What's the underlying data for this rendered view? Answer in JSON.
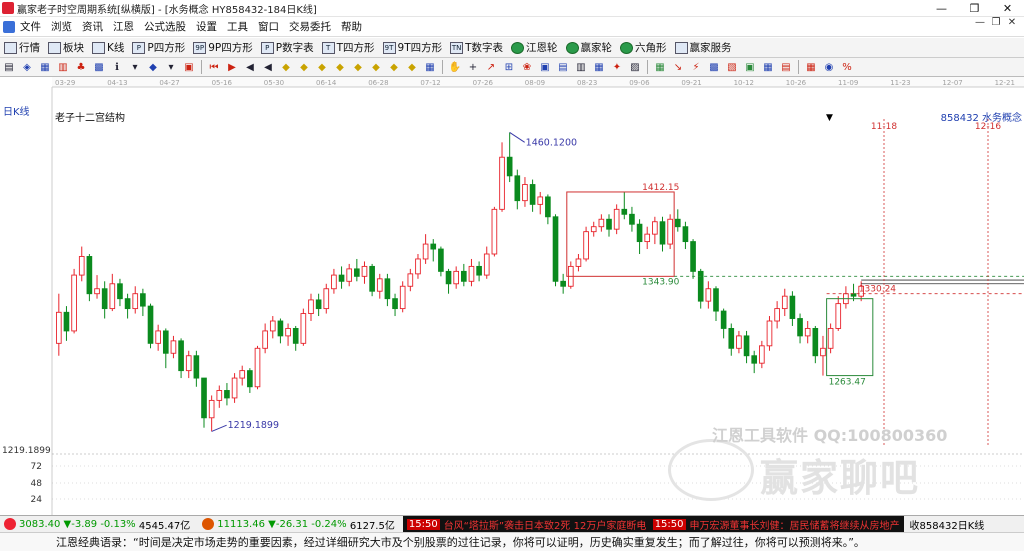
{
  "window": {
    "title": "赢家老子时空周期系统[纵横版] - [水务概念  HY858432-184日K线]",
    "controls": [
      "—",
      "❐",
      "✕"
    ]
  },
  "menu": {
    "items": [
      "文件",
      "浏览",
      "资讯",
      "江恩",
      "公式选股",
      "设置",
      "工具",
      "窗口",
      "交易委托",
      "帮助"
    ],
    "mdi_controls": [
      "—",
      "❐",
      "✕"
    ]
  },
  "toolbar": {
    "items": [
      {
        "label": "行情",
        "icon": "quote-icon"
      },
      {
        "label": "板块",
        "icon": "sector-icon"
      },
      {
        "label": "K线",
        "icon": "kline-icon"
      },
      {
        "label": "P四方形",
        "icon": "square-icon",
        "tag": "P"
      },
      {
        "label": "9P四方形",
        "icon": "square-icon",
        "tag": "9P"
      },
      {
        "label": "P数字表",
        "icon": "table-icon",
        "tag": "P"
      },
      {
        "label": "T四方形",
        "icon": "square-icon",
        "tag": "T"
      },
      {
        "label": "9T四方形",
        "icon": "square-icon",
        "tag": "9T"
      },
      {
        "label": "T数字表",
        "icon": "table-icon",
        "tag": "TN"
      },
      {
        "label": "江恩轮",
        "icon": "wheel-icon"
      },
      {
        "label": "赢家轮",
        "icon": "wheel-icon"
      },
      {
        "label": "六角形",
        "icon": "hexagon-icon"
      },
      {
        "label": "赢家服务",
        "icon": "service-icon"
      }
    ]
  },
  "chart_data": {
    "type": "candlestick",
    "period_label": "日K线",
    "study_label": "老子十二宫结构",
    "stock_label": "858432 水务概念",
    "x_dates": [
      "03-29",
      "04-13",
      "04-27",
      "05-16",
      "05-30",
      "06-14",
      "06-28",
      "07-12",
      "07-26",
      "08-09",
      "08-23",
      "09-06",
      "09-21",
      "10-12",
      "10-26",
      "11-09",
      "11-23",
      "12-07",
      "12-21"
    ],
    "y_axis_labels": [
      "1219.1899",
      "72",
      "48",
      "24"
    ],
    "annotations": [
      "1460.1200",
      "1412.15",
      "1343.90",
      "1330.24",
      "1263.47",
      "1219.1899",
      "11-18",
      "12-16"
    ],
    "candles": [
      [
        1290,
        1315,
        1330,
        1280
      ],
      [
        1315,
        1300,
        1320,
        1292
      ],
      [
        1300,
        1345,
        1350,
        1298
      ],
      [
        1345,
        1360,
        1368,
        1340
      ],
      [
        1360,
        1330,
        1362,
        1324
      ],
      [
        1330,
        1334,
        1345,
        1326
      ],
      [
        1334,
        1318,
        1340,
        1310
      ],
      [
        1318,
        1338,
        1346,
        1316
      ],
      [
        1338,
        1326,
        1342,
        1320
      ],
      [
        1326,
        1318,
        1330,
        1310
      ],
      [
        1318,
        1330,
        1336,
        1314
      ],
      [
        1330,
        1320,
        1334,
        1312
      ],
      [
        1320,
        1290,
        1322,
        1286
      ],
      [
        1290,
        1300,
        1305,
        1284
      ],
      [
        1300,
        1282,
        1302,
        1270
      ],
      [
        1282,
        1292,
        1296,
        1278
      ],
      [
        1292,
        1268,
        1294,
        1262
      ],
      [
        1268,
        1280,
        1284,
        1262
      ],
      [
        1280,
        1262,
        1284,
        1255
      ],
      [
        1262,
        1230,
        1262,
        1222
      ],
      [
        1230,
        1244,
        1248,
        1219
      ],
      [
        1244,
        1252,
        1256,
        1238
      ],
      [
        1252,
        1246,
        1258,
        1240
      ],
      [
        1246,
        1262,
        1266,
        1242
      ],
      [
        1262,
        1268,
        1272,
        1256
      ],
      [
        1268,
        1255,
        1270,
        1250
      ],
      [
        1255,
        1286,
        1288,
        1253
      ],
      [
        1286,
        1300,
        1306,
        1282
      ],
      [
        1300,
        1308,
        1312,
        1294
      ],
      [
        1308,
        1296,
        1310,
        1290
      ],
      [
        1296,
        1302,
        1306,
        1288
      ],
      [
        1302,
        1290,
        1304,
        1284
      ],
      [
        1290,
        1314,
        1318,
        1288
      ],
      [
        1314,
        1325,
        1330,
        1308
      ],
      [
        1325,
        1318,
        1330,
        1312
      ],
      [
        1318,
        1334,
        1338,
        1314
      ],
      [
        1334,
        1345,
        1350,
        1330
      ],
      [
        1345,
        1340,
        1352,
        1334
      ],
      [
        1340,
        1350,
        1354,
        1336
      ],
      [
        1350,
        1344,
        1358,
        1340
      ],
      [
        1344,
        1352,
        1356,
        1338
      ],
      [
        1352,
        1332,
        1354,
        1328
      ],
      [
        1332,
        1342,
        1346,
        1326
      ],
      [
        1342,
        1326,
        1346,
        1320
      ],
      [
        1326,
        1318,
        1330,
        1312
      ],
      [
        1318,
        1336,
        1340,
        1315
      ],
      [
        1336,
        1346,
        1350,
        1332
      ],
      [
        1346,
        1358,
        1362,
        1342
      ],
      [
        1358,
        1370,
        1378,
        1354
      ],
      [
        1370,
        1366,
        1374,
        1356
      ],
      [
        1366,
        1348,
        1368,
        1344
      ],
      [
        1348,
        1338,
        1350,
        1330
      ],
      [
        1338,
        1348,
        1352,
        1334
      ],
      [
        1348,
        1340,
        1354,
        1336
      ],
      [
        1340,
        1352,
        1358,
        1336
      ],
      [
        1352,
        1345,
        1356,
        1340
      ],
      [
        1345,
        1362,
        1368,
        1342
      ],
      [
        1362,
        1398,
        1400,
        1360
      ],
      [
        1398,
        1440,
        1452,
        1396
      ],
      [
        1440,
        1425,
        1460,
        1420
      ],
      [
        1425,
        1405,
        1430,
        1398
      ],
      [
        1405,
        1418,
        1424,
        1400
      ],
      [
        1418,
        1402,
        1422,
        1396
      ],
      [
        1402,
        1408,
        1412,
        1394
      ],
      [
        1408,
        1392,
        1410,
        1386
      ],
      [
        1392,
        1340,
        1394,
        1336
      ],
      [
        1340,
        1336,
        1346,
        1330
      ],
      [
        1336,
        1352,
        1356,
        1334
      ],
      [
        1352,
        1358,
        1362,
        1348
      ],
      [
        1358,
        1380,
        1384,
        1356
      ],
      [
        1380,
        1384,
        1388,
        1376
      ],
      [
        1384,
        1390,
        1394,
        1380
      ],
      [
        1390,
        1382,
        1394,
        1376
      ],
      [
        1382,
        1398,
        1402,
        1378
      ],
      [
        1398,
        1394,
        1412,
        1390
      ],
      [
        1394,
        1386,
        1400,
        1380
      ],
      [
        1386,
        1372,
        1390,
        1362
      ],
      [
        1372,
        1378,
        1384,
        1366
      ],
      [
        1378,
        1388,
        1392,
        1370
      ],
      [
        1388,
        1370,
        1392,
        1364
      ],
      [
        1370,
        1390,
        1394,
        1366
      ],
      [
        1390,
        1384,
        1398,
        1380
      ],
      [
        1384,
        1372,
        1388,
        1366
      ],
      [
        1372,
        1348,
        1374,
        1342
      ],
      [
        1348,
        1324,
        1350,
        1318
      ],
      [
        1324,
        1334,
        1340,
        1318
      ],
      [
        1334,
        1316,
        1336,
        1308
      ],
      [
        1316,
        1302,
        1318,
        1294
      ],
      [
        1302,
        1286,
        1306,
        1280
      ],
      [
        1286,
        1296,
        1300,
        1282
      ],
      [
        1296,
        1280,
        1300,
        1274
      ],
      [
        1280,
        1274,
        1284,
        1266
      ],
      [
        1274,
        1288,
        1292,
        1270
      ],
      [
        1288,
        1308,
        1312,
        1284
      ],
      [
        1308,
        1318,
        1324,
        1302
      ],
      [
        1318,
        1328,
        1334,
        1312
      ],
      [
        1328,
        1310,
        1332,
        1304
      ],
      [
        1310,
        1296,
        1314,
        1290
      ],
      [
        1296,
        1302,
        1308,
        1290
      ],
      [
        1302,
        1280,
        1304,
        1274
      ],
      [
        1280,
        1286,
        1296,
        1264
      ],
      [
        1286,
        1302,
        1306,
        1282
      ],
      [
        1302,
        1322,
        1328,
        1300
      ],
      [
        1322,
        1330,
        1336,
        1318
      ],
      [
        1330,
        1328,
        1338,
        1324
      ],
      [
        1328,
        1336,
        1340,
        1324
      ]
    ]
  },
  "watermark": {
    "line1": "江恩工具软件  QQ:100800360",
    "line2": "赢家聊吧",
    "logo": "赢家 周期"
  },
  "statusbar": {
    "sh_value": "3083.40",
    "sh_change": "▼-3.89",
    "sh_pct": "-0.13%",
    "sh_amount": "4545.47亿",
    "sz_value": "11113.46",
    "sz_change": "▼-26.31",
    "sz_pct": "-0.24%",
    "sz_amount": "6127.5亿",
    "news1_time": "15:50",
    "news1_text": "台风“塔拉斯”袭击日本致2死 12万户家庭断电",
    "news2_time": "15:50",
    "news2_text": "申万宏源董事长刘健：居民储蓄将继续从房地产",
    "tail": "收858432日K线"
  },
  "quote_bar": {
    "text": "江恩经典语录：“时间是决定市场走势的重要因素，经过详细研究大市及个别股票的过往记录，你将可以证明，历史确实重复发生；而了解过往，你将可以预测将来。”。"
  },
  "colors": {
    "up": "#e8232b",
    "down": "#0b8a1e",
    "price_line": "#3a3aa8"
  }
}
